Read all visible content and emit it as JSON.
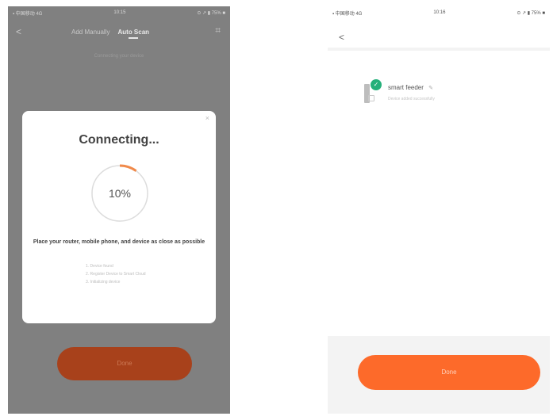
{
  "left_screen": {
    "status_bar": {
      "signal": "▪ 中国移动 4G",
      "time": "10:15",
      "battery": "⊙ ↗ ▮ 75% ■"
    },
    "nav": {
      "back": "<",
      "tab_add_manually": "Add Manually",
      "tab_auto_scan": "Auto Scan",
      "scan_icon": "⌗"
    },
    "subtitle": "Connecting your device",
    "dialog": {
      "close": "×",
      "title": "Connecting...",
      "progress": {
        "percent_label": "10%",
        "value": 0.1,
        "accent": "#f08a4b",
        "track": "#dcdcdc"
      },
      "tip": "Place your router, mobile phone, and device as close as possible",
      "steps": [
        "1. Device found",
        "2. Register Device to Smart Cloud",
        "3. Initializing device"
      ]
    },
    "button": {
      "label": "Done"
    }
  },
  "right_screen": {
    "status_bar": {
      "signal": "▪ 中国移动 4G",
      "time": "10:16",
      "battery": "⊙ ↗ ▮ 75% ■"
    },
    "nav": {
      "back": "<"
    },
    "device": {
      "name": "smart feeder",
      "edit_icon": "✎",
      "status": "Device added successfully"
    },
    "button": {
      "label": "Done"
    }
  },
  "colors": {
    "accent": "#fd6a2a",
    "overlay": "#808080",
    "success": "#25b07a"
  }
}
